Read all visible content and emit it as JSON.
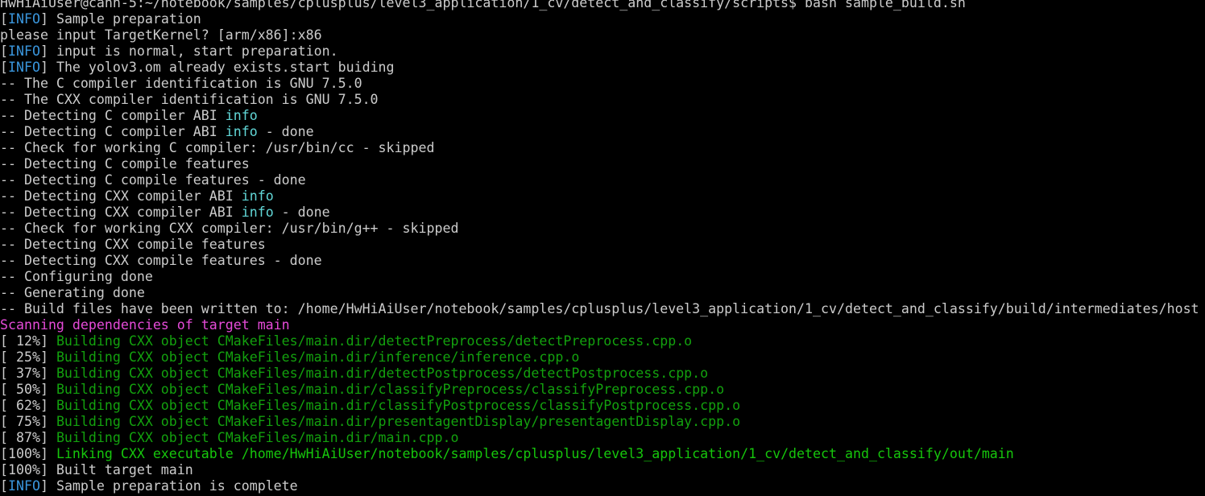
{
  "colors": {
    "background": "#000000",
    "text": "#cccccc",
    "info_tag": "#3a96dd",
    "info_word": "#61d6d6",
    "build_green": "#13a10e",
    "scanning_magenta": "#e64bd9"
  },
  "lines": [
    {
      "segs": [
        {
          "t": "HwHiAiUser@cann-5:~/notebook/samples/cplusplus/level3_application/1_cv/detect_and_classify/scripts$ bash sample_build.sh",
          "c": "white"
        }
      ]
    },
    {
      "segs": [
        {
          "t": "[",
          "c": "white"
        },
        {
          "t": "INFO",
          "c": "blue"
        },
        {
          "t": "] Sample preparation",
          "c": "white"
        }
      ]
    },
    {
      "segs": [
        {
          "t": "please input TargetKernel? [arm/x86]:x86",
          "c": "white"
        }
      ]
    },
    {
      "segs": [
        {
          "t": "[",
          "c": "white"
        },
        {
          "t": "INFO",
          "c": "blue"
        },
        {
          "t": "] input is normal, start preparation.",
          "c": "white"
        }
      ]
    },
    {
      "segs": [
        {
          "t": "[",
          "c": "white"
        },
        {
          "t": "INFO",
          "c": "blue"
        },
        {
          "t": "] The yolov3.om already exists.start buiding",
          "c": "white"
        }
      ]
    },
    {
      "segs": [
        {
          "t": "-- The C compiler identification is GNU 7.5.0",
          "c": "white"
        }
      ]
    },
    {
      "segs": [
        {
          "t": "-- The CXX compiler identification is GNU 7.5.0",
          "c": "white"
        }
      ]
    },
    {
      "segs": [
        {
          "t": "-- Detecting C compiler ABI ",
          "c": "white"
        },
        {
          "t": "info",
          "c": "info"
        }
      ]
    },
    {
      "segs": [
        {
          "t": "-- Detecting C compiler ABI ",
          "c": "white"
        },
        {
          "t": "info",
          "c": "info"
        },
        {
          "t": " - done",
          "c": "white"
        }
      ]
    },
    {
      "segs": [
        {
          "t": "-- Check for working C compiler: /usr/bin/cc - skipped",
          "c": "white"
        }
      ]
    },
    {
      "segs": [
        {
          "t": "-- Detecting C compile features",
          "c": "white"
        }
      ]
    },
    {
      "segs": [
        {
          "t": "-- Detecting C compile features - done",
          "c": "white"
        }
      ]
    },
    {
      "segs": [
        {
          "t": "-- Detecting CXX compiler ABI ",
          "c": "white"
        },
        {
          "t": "info",
          "c": "info"
        }
      ]
    },
    {
      "segs": [
        {
          "t": "-- Detecting CXX compiler ABI ",
          "c": "white"
        },
        {
          "t": "info",
          "c": "info"
        },
        {
          "t": " - done",
          "c": "white"
        }
      ]
    },
    {
      "segs": [
        {
          "t": "-- Check for working CXX compiler: /usr/bin/g++ - skipped",
          "c": "white"
        }
      ]
    },
    {
      "segs": [
        {
          "t": "-- Detecting CXX compile features",
          "c": "white"
        }
      ]
    },
    {
      "segs": [
        {
          "t": "-- Detecting CXX compile features - done",
          "c": "white"
        }
      ]
    },
    {
      "segs": [
        {
          "t": "-- Configuring done",
          "c": "white"
        }
      ]
    },
    {
      "segs": [
        {
          "t": "-- Generating done",
          "c": "white"
        }
      ]
    },
    {
      "segs": [
        {
          "t": "-- Build files have been written to: /home/HwHiAiUser/notebook/samples/cplusplus/level3_application/1_cv/detect_and_classify/build/intermediates/host",
          "c": "white"
        }
      ]
    },
    {
      "segs": [
        {
          "t": "Scanning dependencies of target main",
          "c": "magenta"
        }
      ]
    },
    {
      "segs": [
        {
          "t": "[ 12%] ",
          "c": "white"
        },
        {
          "t": "Building CXX object CMakeFiles/main.dir/detectPreprocess/detectPreprocess.cpp.o",
          "c": "green2"
        }
      ]
    },
    {
      "segs": [
        {
          "t": "[ 25%] ",
          "c": "white"
        },
        {
          "t": "Building CXX object CMakeFiles/main.dir/inference/inference.cpp.o",
          "c": "green2"
        }
      ]
    },
    {
      "segs": [
        {
          "t": "[ 37%] ",
          "c": "white"
        },
        {
          "t": "Building CXX object CMakeFiles/main.dir/detectPostprocess/detectPostprocess.cpp.o",
          "c": "green2"
        }
      ]
    },
    {
      "segs": [
        {
          "t": "[ 50%] ",
          "c": "white"
        },
        {
          "t": "Building CXX object CMakeFiles/main.dir/classifyPreprocess/classifyPreprocess.cpp.o",
          "c": "green2"
        }
      ]
    },
    {
      "segs": [
        {
          "t": "[ 62%] ",
          "c": "white"
        },
        {
          "t": "Building CXX object CMakeFiles/main.dir/classifyPostprocess/classifyPostprocess.cpp.o",
          "c": "green2"
        }
      ]
    },
    {
      "segs": [
        {
          "t": "[ 75%] ",
          "c": "white"
        },
        {
          "t": "Building CXX object CMakeFiles/main.dir/presentagentDisplay/presentagentDisplay.cpp.o",
          "c": "green2"
        }
      ]
    },
    {
      "segs": [
        {
          "t": "[ 87%] ",
          "c": "white"
        },
        {
          "t": "Building CXX object CMakeFiles/main.dir/main.cpp.o",
          "c": "green2"
        }
      ]
    },
    {
      "segs": [
        {
          "t": "[100%] ",
          "c": "white"
        },
        {
          "t": "Linking CXX executable /home/HwHiAiUser/notebook/samples/cplusplus/level3_application/1_cv/detect_and_classify/out/main",
          "c": "green"
        }
      ]
    },
    {
      "segs": [
        {
          "t": "[100%] Built target main",
          "c": "white"
        }
      ]
    },
    {
      "segs": [
        {
          "t": "[",
          "c": "white"
        },
        {
          "t": "INFO",
          "c": "blue"
        },
        {
          "t": "] Sample preparation is complete",
          "c": "white"
        }
      ]
    }
  ]
}
